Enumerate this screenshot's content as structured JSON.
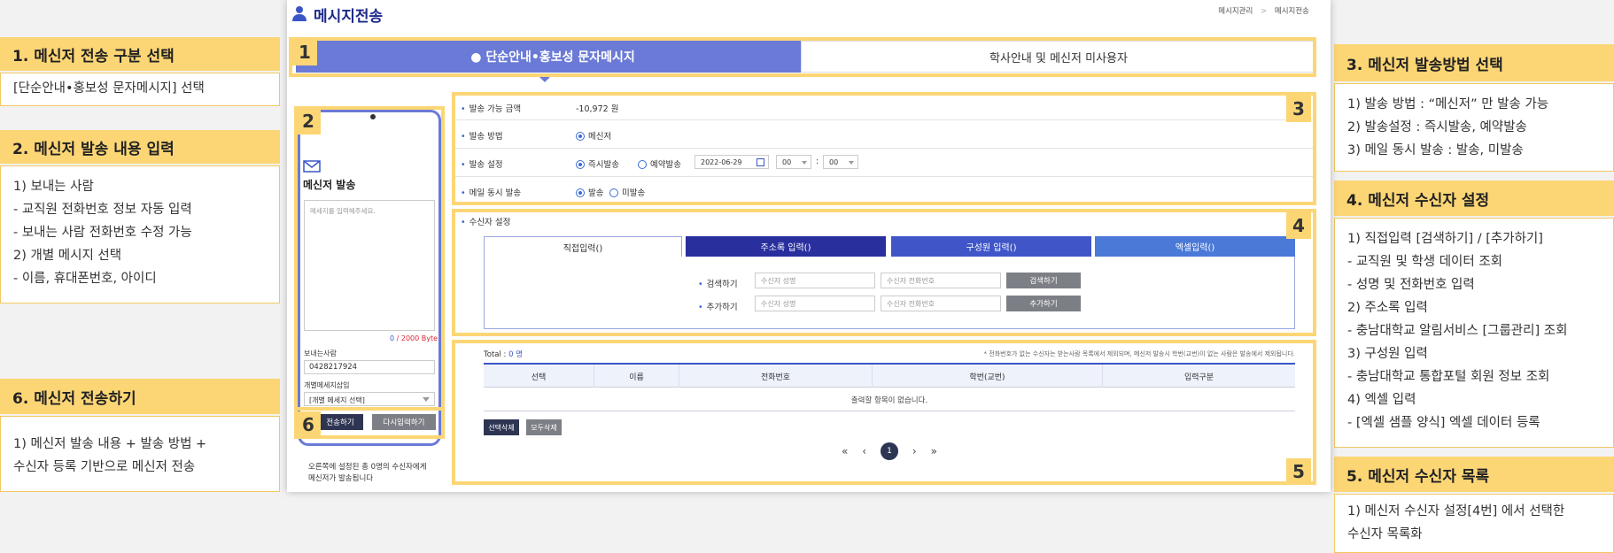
{
  "annotations": {
    "a1": {
      "title": "1. 메신저 전송 구분 선택",
      "body": "[단순안내•홍보성 문자메시지] 선택"
    },
    "a2": {
      "title": "2. 메신저 발송 내용 입력",
      "body": "1) 보내는 사람\n - 교직원 전화번호 정보 자동 입력\n - 보내는 사람 전화번호 수정 가능\n2) 개별 메시지 선택\n - 이름, 휴대폰번호, 아이디"
    },
    "a6": {
      "title": "6. 메신저 전송하기",
      "body": "1) 메신저 발송 내용 + 발송 방법 +\n   수신자 등록 기반으로 메신저 전송"
    },
    "a3": {
      "title": "3. 메신저 발송방법 선택",
      "body": "1) 발송 방법 : “메신저” 만 발송 가능\n2) 발송설정 : 즉시발송, 예약발송\n3) 메일 동시 발송 : 발송, 미발송"
    },
    "a4": {
      "title": "4. 메신저 수신자 설정",
      "body": "1) 직접입력 [검색하기] / [추가하기]\n - 교직원 및 학생 데이터 조회\n - 성명 및 전화번호 입력\n2) 주소록 입력\n - 충남대학교 알림서비스 [그룹관리] 조회\n3) 구성원 입력\n - 충남대학교 통합포털 회원 정보 조회\n4) 엑셀 입력\n - [엑셀 샘플 양식] 엑셀 데이터 등록"
    },
    "a5": {
      "title": "5. 메신저 수신자 목록",
      "body": "1) 메신저 수신자 설정[4번] 에서 선택한\n   수신자 목록화"
    }
  },
  "nums": [
    "1",
    "2",
    "3",
    "4",
    "5",
    "6"
  ],
  "header": {
    "title": "메시지전송",
    "breadcrumb_1": "메시지관리",
    "breadcrumb_sep": ">",
    "breadcrumb_2": "메시지전송"
  },
  "tabs": {
    "simple": "● 단순안내•홍보성 문자메시지",
    "academic": "학사안내 및 메신저 미사용자"
  },
  "phone": {
    "title": "메신저 발송",
    "placeholder": "메세지를 입력해주세요.",
    "byte_count": "0",
    "byte_max": "/ 2000 Byte",
    "sender_label": "보내는사람",
    "sender_value": "0428217924",
    "individual_label": "개별메세지삽입",
    "individual_select": "[개별 메세지 선택]",
    "send_btn": "전송하기",
    "reset_btn": "다시입력하기",
    "note": "오른쪽에 설정된 총 0명의 수신자에게\n메신저가 발송됩니다"
  },
  "settings": {
    "balance_label": "발송 가능 금액",
    "balance_value": "-10,972 원",
    "method_label": "발송 방법",
    "method_value": "메신저",
    "schedule_label": "발송 설정",
    "schedule_now": "즉시발송",
    "schedule_reserve": "예약발송",
    "date": "2022-06-29",
    "hour": "00",
    "minute": "00",
    "colon": ":",
    "mail_label": "메일 동시 발송",
    "mail_send": "발송",
    "mail_nosend": "미발송"
  },
  "recipients": {
    "title": "수신자 설정",
    "tabs": [
      "직접입력()",
      "주소록 입력()",
      "구성원 입력()",
      "엑셀입력()"
    ],
    "search_label": "검색하기",
    "add_label": "추가하기",
    "name_ph": "수신자 성명",
    "phone_ph": "수신자 전화번호",
    "search_btn": "검색하기",
    "add_btn": "추가하기"
  },
  "list": {
    "total_label": "Total : ",
    "total_value": "0 명",
    "notice": "* 전화번호가 없는 수신자는 받는사람 목록에서 제외되며, 메신저 발송시 학번(교번)이 없는 사람은 발송에서 제외됩니다.",
    "columns": [
      "선택",
      "이름",
      "전화번호",
      "학번(교번)",
      "입력구분"
    ],
    "empty": "출력할 항목이 없습니다.",
    "delete_selected": "선택삭제",
    "delete_all": "모두삭제",
    "pager": [
      "«",
      "‹",
      "1",
      "›",
      "»"
    ]
  },
  "colors": {
    "accent": "#fcd675",
    "tab_blue": "#6a7ad6",
    "navy": "#2a2f9e",
    "mid_blue": "#3f55c8",
    "light_blue": "#4a79d8",
    "dark_btn": "#2e3553"
  }
}
